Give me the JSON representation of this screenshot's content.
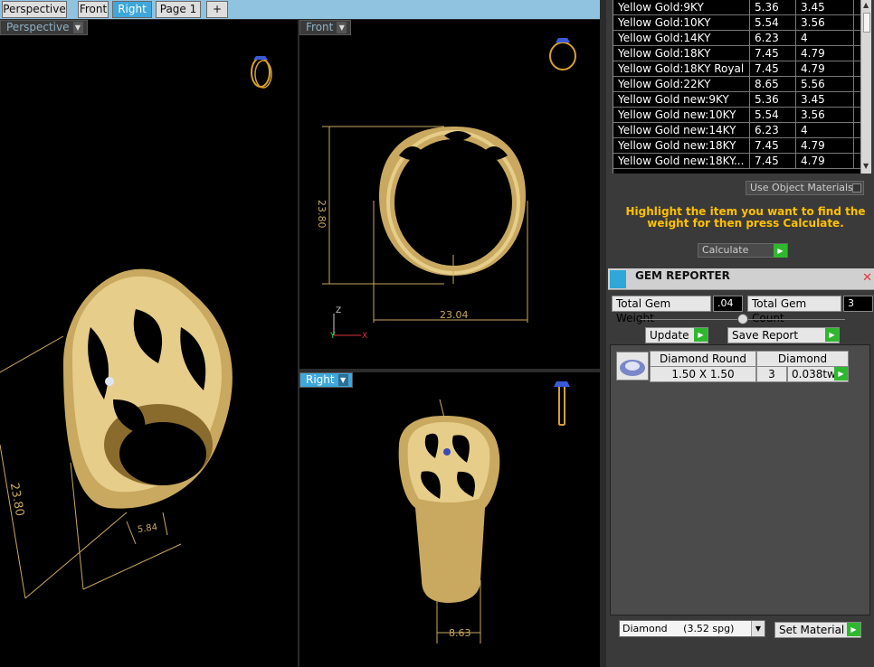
{
  "tabs": [
    "Perspective",
    "Front",
    "Right",
    "Page 1",
    "+"
  ],
  "viewports": {
    "perspective": {
      "label": "Perspective",
      "dims": [
        "23.80",
        "5.84"
      ]
    },
    "front": {
      "label": "Front",
      "dims": [
        "23.80",
        "23.04"
      ],
      "axes": [
        "Z",
        "Y",
        "X"
      ]
    },
    "right": {
      "label": "Right",
      "dims": [
        "8.63"
      ]
    }
  },
  "materials": [
    [
      "Yellow Gold:9KY",
      "5.36",
      "3.45"
    ],
    [
      "Yellow Gold:10KY",
      "5.54",
      "3.56"
    ],
    [
      "Yellow Gold:14KY",
      "6.23",
      "4"
    ],
    [
      "Yellow Gold:18KY",
      "7.45",
      "4.79"
    ],
    [
      "Yellow Gold:18KY Royal",
      "7.45",
      "4.79"
    ],
    [
      "Yellow Gold:22KY",
      "8.65",
      "5.56"
    ],
    [
      "Yellow Gold new:9KY",
      "5.36",
      "3.45"
    ],
    [
      "Yellow Gold new:10KY",
      "5.54",
      "3.56"
    ],
    [
      "Yellow Gold new:14KY",
      "6.23",
      "4"
    ],
    [
      "Yellow Gold new:18KY",
      "7.45",
      "4.79"
    ],
    [
      "Yellow Gold new:18KY...",
      "7.45",
      "4.79"
    ]
  ],
  "use_object_materials": "Use Object Materials",
  "notice": "Highlight the item you want to find the weight for then press Calculate.",
  "calculate": "Calculate",
  "gem_reporter": {
    "title": "GEM REPORTER",
    "total_weight_label": "Total Gem Weight",
    "total_weight": ".04",
    "total_count_label": "Total Gem Count",
    "total_count": "3",
    "update": "Update",
    "save_report": "Save Report",
    "gem": {
      "type": "Diamond Round",
      "material": "Diamond",
      "size": "1.50 X 1.50",
      "count": "3",
      "weight": "0.038tw"
    }
  },
  "material_select": "Diamond     (3.52 spg)",
  "set_material": "Set Material",
  "colors": {
    "accent": "#3fa7dc",
    "gold": "#c9a860",
    "notice": "#ffc000",
    "green": "#2fb82f"
  }
}
